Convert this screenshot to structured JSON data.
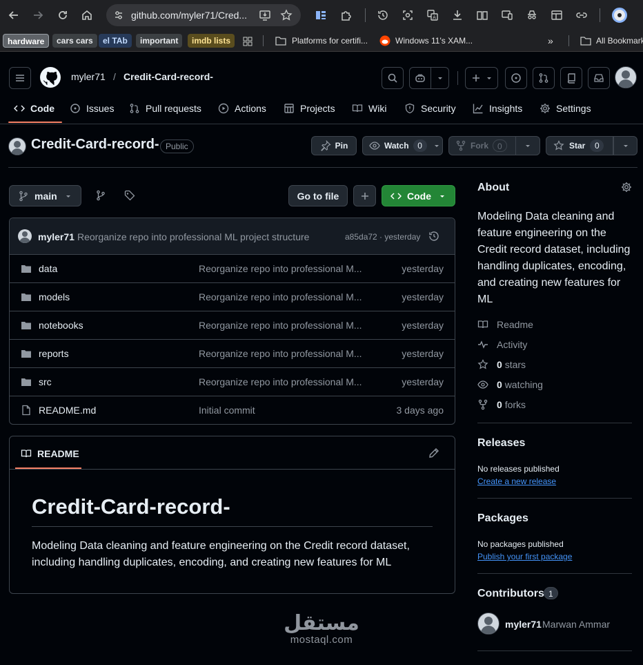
{
  "browser": {
    "url": "github.com/myler71/Cred...",
    "bookmarks": [
      {
        "label": "hardware",
        "bg": "#5f6368",
        "fg": "#ffffff"
      },
      {
        "label": "cars cars",
        "bg": "#3c4043",
        "fg": "#e8eaed"
      },
      {
        "label": "el TAb",
        "bg": "#273a59",
        "fg": "#c2dbff"
      },
      {
        "label": "important",
        "bg": "#3c4043",
        "fg": "#e8eaed"
      },
      {
        "label": "imdb lists",
        "bg": "#5a4d1e",
        "fg": "#fde293"
      }
    ],
    "bookmark_plain": {
      "platforms": "Platforms for certifi...",
      "windows": "Windows 11's XAM...",
      "all": "All Bookmarks"
    }
  },
  "header": {
    "owner": "myler71",
    "separator": "/",
    "repo": "Credit-Card-record-"
  },
  "nav": {
    "code": "Code",
    "issues": "Issues",
    "pull_requests": "Pull requests",
    "actions": "Actions",
    "projects": "Projects",
    "wiki": "Wiki",
    "security": "Security",
    "insights": "Insights",
    "settings": "Settings"
  },
  "repo": {
    "title": "Credit-Card-record-",
    "visibility": "Public",
    "pin": "Pin",
    "watch": "Watch",
    "watch_count": "0",
    "fork": "Fork",
    "fork_count": "0",
    "star": "Star",
    "star_count": "0"
  },
  "toolbar": {
    "branch": "main",
    "go_to_file": "Go to file",
    "plus": "+",
    "code": "Code"
  },
  "commit": {
    "author": "myler71",
    "message": "Reorganize repo into professional ML project structure",
    "meta": "a85da72 · yesterday"
  },
  "files": [
    {
      "name": "data",
      "type": "folder",
      "message": "Reorganize repo into professional M...",
      "time": "yesterday"
    },
    {
      "name": "models",
      "type": "folder",
      "message": "Reorganize repo into professional M...",
      "time": "yesterday"
    },
    {
      "name": "notebooks",
      "type": "folder",
      "message": "Reorganize repo into professional M...",
      "time": "yesterday"
    },
    {
      "name": "reports",
      "type": "folder",
      "message": "Reorganize repo into professional M...",
      "time": "yesterday"
    },
    {
      "name": "src",
      "type": "folder",
      "message": "Reorganize repo into professional M...",
      "time": "yesterday"
    },
    {
      "name": "README.md",
      "type": "file",
      "message": "Initial commit",
      "time": "3 days ago"
    }
  ],
  "readme": {
    "tab": "README",
    "heading": "Credit-Card-record-",
    "line1": "Modeling Data cleaning and feature engineering on the Credit record dataset,",
    "line2": "including handling duplicates, encoding, and creating new features for ML"
  },
  "about": {
    "title": "About",
    "desc": [
      "Modeling Data cleaning and",
      "feature engineering on the",
      "Credit record dataset, including",
      "handling duplicates, encoding,",
      "and creating new features for",
      "ML"
    ],
    "readme": "Readme",
    "activity": "Activity",
    "stars_count": "0",
    "stars_label": "stars",
    "watching_count": "0",
    "watching_label": "watching",
    "forks_count": "0",
    "forks_label": "forks"
  },
  "releases": {
    "title": "Releases",
    "none": "No releases published",
    "create": "Create a new release"
  },
  "packages": {
    "title": "Packages",
    "none": "No packages published",
    "publish": "Publish your first package"
  },
  "contributors": {
    "title": "Contributors",
    "count": "1",
    "user": "myler71",
    "fullname": "Marwan Ammar"
  },
  "watermark": {
    "arabic": "مستقل",
    "latin": "mostaql.com"
  },
  "colors": {
    "accent_green": "#238636",
    "link_blue": "#4493f8",
    "nav_underline": "#f78166"
  }
}
